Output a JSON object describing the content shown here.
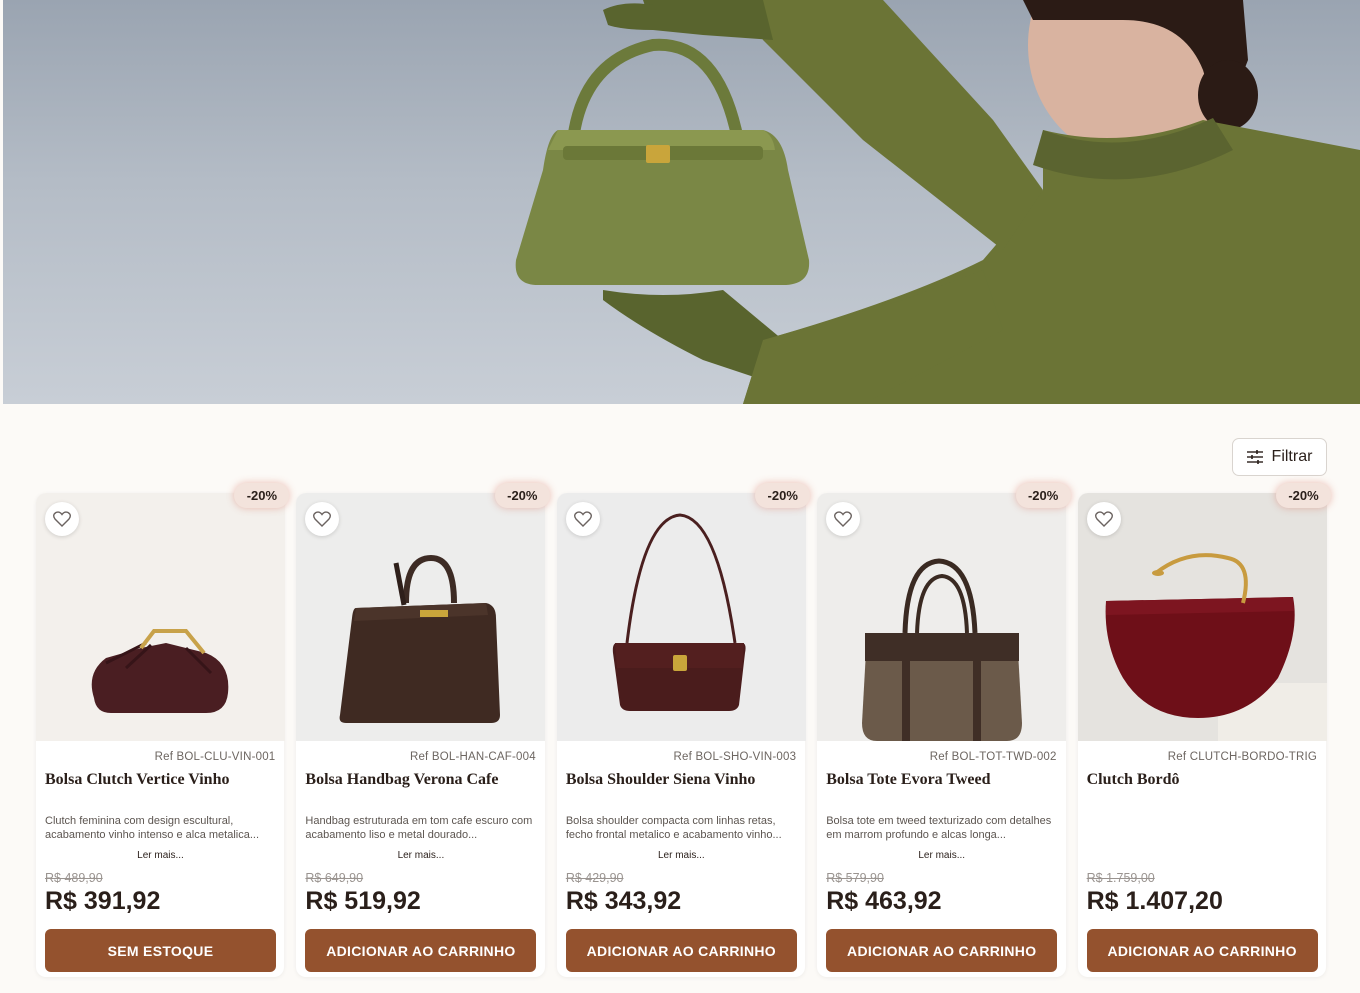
{
  "filter": {
    "label": "Filtrar"
  },
  "products": [
    {
      "ref": "Ref BOL-CLU-VIN-001",
      "title": "Bolsa Clutch Vertice Vinho",
      "description": "Clutch feminina com design escultural, acabamento vinho intenso e alca metalica...",
      "more": "Ler mais...",
      "old_price": "R$ 489,90",
      "price": "R$ 391,92",
      "discount": "-20%",
      "cta": "SEM ESTOQUE"
    },
    {
      "ref": "Ref BOL-HAN-CAF-004",
      "title": "Bolsa Handbag Verona Cafe",
      "description": "Handbag estruturada em tom cafe escuro com acabamento liso e metal dourado...",
      "more": "Ler mais...",
      "old_price": "R$ 649,90",
      "price": "R$ 519,92",
      "discount": "-20%",
      "cta": "ADICIONAR AO CARRINHO"
    },
    {
      "ref": "Ref BOL-SHO-VIN-003",
      "title": "Bolsa Shoulder Siena Vinho",
      "description": "Bolsa shoulder compacta com linhas retas, fecho frontal metalico e acabamento vinho...",
      "more": "Ler mais...",
      "old_price": "R$ 429,90",
      "price": "R$ 343,92",
      "discount": "-20%",
      "cta": "ADICIONAR AO CARRINHO"
    },
    {
      "ref": "Ref BOL-TOT-TWD-002",
      "title": "Bolsa Tote Evora Tweed",
      "description": "Bolsa tote em tweed texturizado com detalhes em marrom profundo e alcas longa...",
      "more": "Ler mais...",
      "old_price": "R$ 579,90",
      "price": "R$ 463,92",
      "discount": "-20%",
      "cta": "ADICIONAR AO CARRINHO"
    },
    {
      "ref": "Ref CLUTCH-BORDO-TRIG",
      "title": "Clutch Bordô",
      "description": "",
      "more": "",
      "old_price": "R$ 1.759,00",
      "price": "R$ 1.407,20",
      "discount": "-20%",
      "cta": "ADICIONAR AO CARRINHO"
    }
  ],
  "colors": {
    "accent": "#94522e",
    "background": "#fcfaf7",
    "badge": "#f3e3dc",
    "sweater": "#6b7436"
  }
}
